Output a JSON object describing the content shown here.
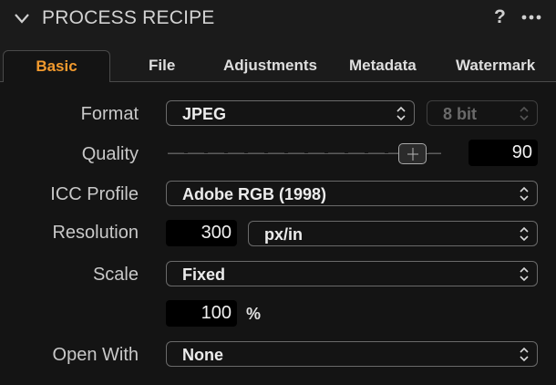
{
  "panel": {
    "title": "PROCESS RECIPE",
    "help": "?",
    "collapse_icon": "chevron-down-icon",
    "more_icon": "more-horizontal-icon"
  },
  "tabs": [
    {
      "label": "Basic",
      "active": true
    },
    {
      "label": "File"
    },
    {
      "label": "Adjustments"
    },
    {
      "label": "Metadata"
    },
    {
      "label": "Watermark"
    }
  ],
  "colors": {
    "accent": "#f29a2e",
    "background": "#141414",
    "field": "#000000"
  },
  "form": {
    "format": {
      "label": "Format",
      "value": "JPEG",
      "bit_depth": "8 bit"
    },
    "quality": {
      "label": "Quality",
      "value": "90",
      "slider_fraction": 0.9
    },
    "icc": {
      "label": "ICC Profile",
      "value": "Adobe RGB (1998)"
    },
    "resolution": {
      "label": "Resolution",
      "value": "300",
      "unit": "px/in"
    },
    "scale": {
      "label": "Scale",
      "value": "Fixed",
      "percent_value": "100",
      "percent_unit": "%"
    },
    "open_with": {
      "label": "Open With",
      "value": "None"
    }
  }
}
